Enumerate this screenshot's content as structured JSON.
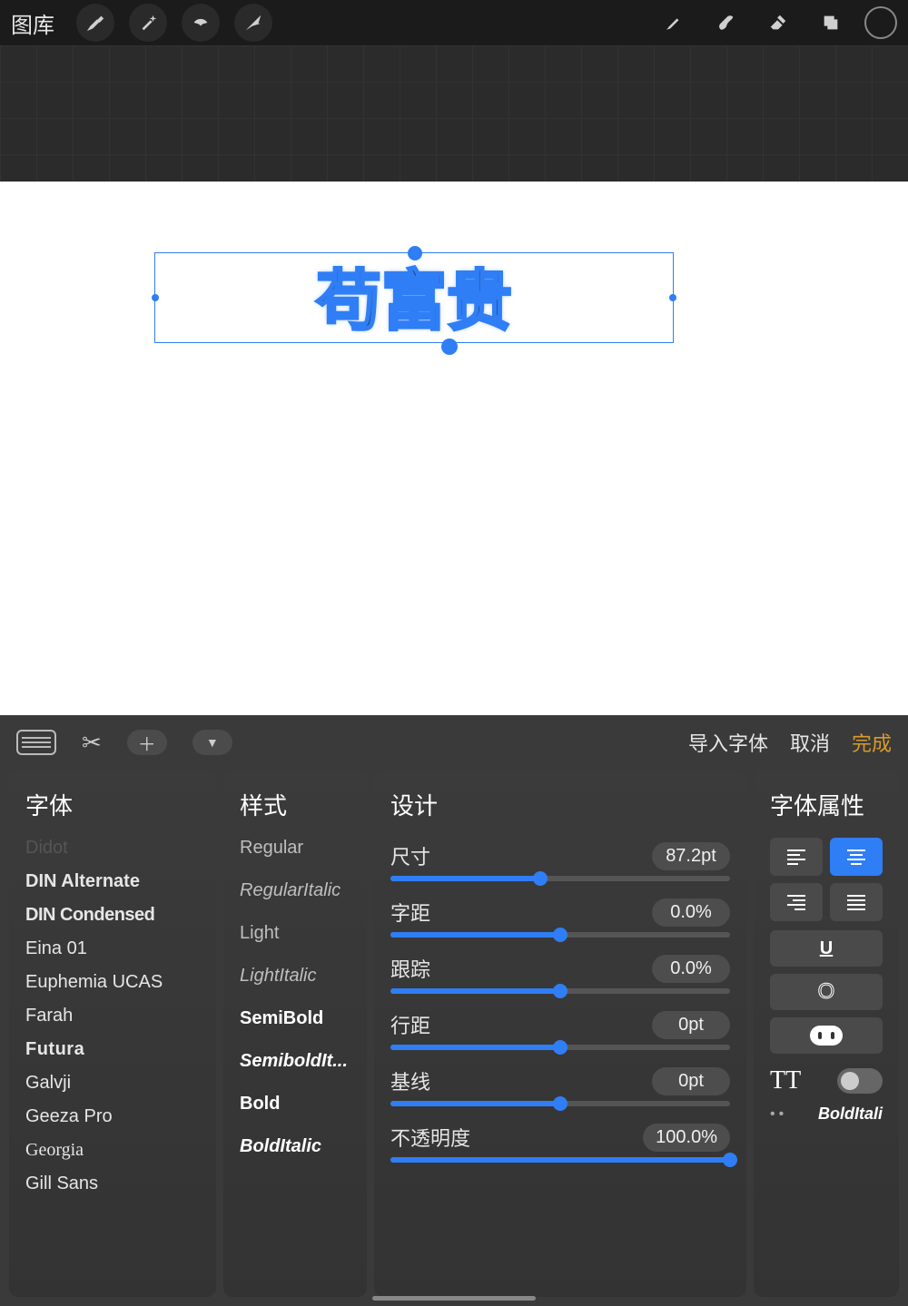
{
  "topbar": {
    "gallery": "图库"
  },
  "canvas": {
    "text": "苟富贵"
  },
  "action_bar": {
    "import_font": "导入字体",
    "cancel": "取消",
    "done": "完成"
  },
  "font_panel": {
    "title": "字体",
    "items": [
      {
        "name": "Didot",
        "class": "dim"
      },
      {
        "name": "DIN Alternate",
        "class": "semi"
      },
      {
        "name": "DIN Condensed",
        "class": "cond"
      },
      {
        "name": "Eina 01",
        "class": ""
      },
      {
        "name": "Euphemia  UCAS",
        "class": ""
      },
      {
        "name": "Farah",
        "class": ""
      },
      {
        "name": "Futura",
        "class": "futura"
      },
      {
        "name": "Galvji",
        "class": ""
      },
      {
        "name": "Geeza Pro",
        "class": ""
      },
      {
        "name": "Georgia",
        "class": "georgia"
      },
      {
        "name": "Gill Sans",
        "class": ""
      }
    ]
  },
  "style_panel": {
    "title": "样式",
    "items": [
      {
        "name": "Regular",
        "class": ""
      },
      {
        "name": "RegularItalic",
        "class": "i"
      },
      {
        "name": "Light",
        "class": ""
      },
      {
        "name": "LightItalic",
        "class": "i"
      },
      {
        "name": "SemiBold",
        "class": "b"
      },
      {
        "name": "SemiboldIt...",
        "class": "b i"
      },
      {
        "name": "Bold",
        "class": "b"
      },
      {
        "name": "BoldItalic",
        "class": "b i"
      }
    ]
  },
  "design_panel": {
    "title": "设计",
    "rows": [
      {
        "key": "size",
        "label": "尺寸",
        "value": "87.2pt",
        "pct": 44
      },
      {
        "key": "kerning",
        "label": "字距",
        "value": "0.0%",
        "pct": 50
      },
      {
        "key": "tracking",
        "label": "跟踪",
        "value": "0.0%",
        "pct": 50
      },
      {
        "key": "leading",
        "label": "行距",
        "value": "0pt",
        "pct": 50
      },
      {
        "key": "baseline",
        "label": "基线",
        "value": "0pt",
        "pct": 50
      },
      {
        "key": "opacity",
        "label": "不透明度",
        "value": "100.0%",
        "pct": 100
      }
    ]
  },
  "attr_panel": {
    "title": "字体属性",
    "bolditalic_label": "BoldItali",
    "tt_label": "TT"
  }
}
